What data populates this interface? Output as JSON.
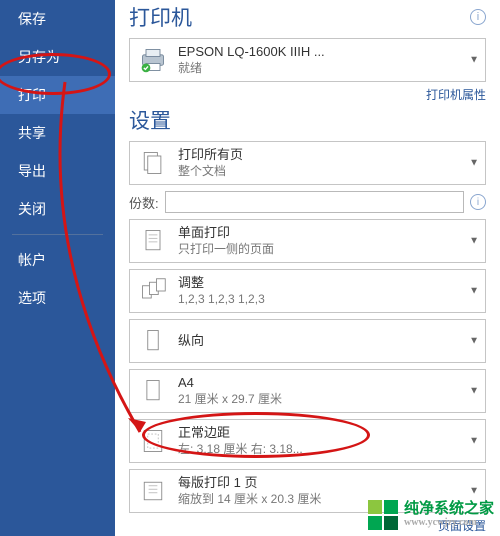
{
  "sidebar": {
    "items": [
      {
        "label": "保存",
        "name": "sidebar-item-save",
        "active": false
      },
      {
        "label": "另存为",
        "name": "sidebar-item-save-as",
        "active": false
      },
      {
        "label": "打印",
        "name": "sidebar-item-print",
        "active": true
      },
      {
        "label": "共享",
        "name": "sidebar-item-share",
        "active": false
      },
      {
        "label": "导出",
        "name": "sidebar-item-export",
        "active": false
      },
      {
        "label": "关闭",
        "name": "sidebar-item-close",
        "active": false
      }
    ],
    "footer": [
      {
        "label": "帐户",
        "name": "sidebar-item-account"
      },
      {
        "label": "选项",
        "name": "sidebar-item-options"
      }
    ]
  },
  "sections": {
    "printer_title": "打印机",
    "settings_title": "设置"
  },
  "printer": {
    "name": "EPSON LQ-1600K IIIH ...",
    "status": "就绪",
    "properties_link": "打印机属性"
  },
  "copies": {
    "label": "份数:",
    "value": ""
  },
  "settings": [
    {
      "name": "setting-print-range",
      "t1": "打印所有页",
      "t2": "整个文档",
      "icon": "pages"
    },
    {
      "name": "setting-one-sided",
      "t1": "单面打印",
      "t2": "只打印一侧的页面",
      "icon": "one-sided"
    },
    {
      "name": "setting-collation",
      "t1": "调整",
      "t2": "1,2,3    1,2,3    1,2,3",
      "icon": "collate"
    },
    {
      "name": "setting-orientation",
      "t1": "纵向",
      "t2": "",
      "icon": "portrait"
    },
    {
      "name": "setting-paper-size",
      "t1": "A4",
      "t2": "21 厘米 x 29.7 厘米",
      "icon": "a4"
    },
    {
      "name": "setting-margins",
      "t1": "正常边距",
      "t2": "左:  3.18 厘米   右:  3.18...",
      "icon": "margins"
    },
    {
      "name": "setting-pages-per-sheet",
      "t1": "每版打印 1 页",
      "t2": "缩放到 14 厘米 x 20.3 厘米",
      "icon": "per-sheet"
    }
  ],
  "page_setup_link": "页面设置",
  "watermark": {
    "cn": "纯净系统之家",
    "en": "www.ycwjzy.com"
  }
}
